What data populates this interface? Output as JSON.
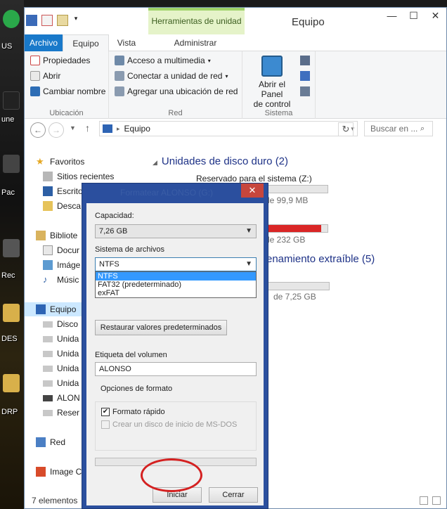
{
  "desktop": {
    "labels": [
      "US",
      "une",
      "Pac",
      "Rec",
      "DES",
      "DRP"
    ]
  },
  "window": {
    "title": "Equipo",
    "context_tab": "Herramientas de unidad",
    "controls": {
      "minimize": "—",
      "maximize": "☐",
      "close": "✕"
    }
  },
  "tabs": {
    "file": "Archivo",
    "computer": "Equipo",
    "view": "Vista",
    "manage": "Administrar"
  },
  "ribbon": {
    "location": {
      "label": "Ubicación",
      "properties": "Propiedades",
      "open": "Abrir",
      "rename": "Cambiar nombre"
    },
    "network": {
      "label": "Red",
      "media": "Acceso a multimedia",
      "map_drive": "Conectar a unidad de red",
      "add_location": "Agregar una ubicación de red"
    },
    "system": {
      "label": "Sistema",
      "control_panel": "Abrir el Panel de control",
      "control_panel_line1": "Abrir el Panel",
      "control_panel_line2": "de control"
    }
  },
  "address": {
    "path": "Equipo",
    "search_placeholder": "Buscar en ..."
  },
  "nav": {
    "favorites": "Favoritos",
    "recent": "Sitios recientes",
    "desktop": "Escrito",
    "downloads": "Desca",
    "libraries": "Bibliote",
    "documents": "Docur",
    "images": "Imáge",
    "music": "Músic",
    "computer": "Equipo",
    "disk": "Disco",
    "unit1": "Unida",
    "unit2": "Unida",
    "unit3": "Unida",
    "unit4": "Unida",
    "alonso": "ALON",
    "reserved": "Reser",
    "network": "Red",
    "image": "Image C"
  },
  "content": {
    "hard_drives_heading": "Unidades de disco duro (2)",
    "reserved_name": "Reservado para el sistema (Z:)",
    "reserved_free": "de 99,9 MB",
    "reserved_used_fraction": 0.36,
    "drive_c_free": "de 232 GB",
    "drive_c_used_fraction": 0.95,
    "removable_heading": "enamiento extraíble (5)",
    "removable_free": "de 7,25 GB",
    "removable_used_fraction": 0.02
  },
  "status": {
    "items": "7 elementos"
  },
  "dialog": {
    "title": "Formatear ALONSO (G:)",
    "close": "✕",
    "capacity_label": "Capacidad:",
    "capacity_value": "7,26 GB",
    "fs_label": "Sistema de archivos",
    "fs_value": "NTFS",
    "fs_options": [
      "NTFS",
      "FAT32 (predeterminado)",
      "exFAT"
    ],
    "restore_button": "Restaurar valores predeterminados",
    "volume_label": "Etiqueta del volumen",
    "volume_value": "ALONSO",
    "format_options_label": "Opciones de formato",
    "quick_format": "Formato rápido",
    "quick_format_checked": true,
    "msdos_disk": "Crear un disco de inicio de MS-DOS",
    "msdos_checked": false,
    "progress": 0,
    "start_button": "Iniciar",
    "cancel_button": "Cerrar"
  }
}
